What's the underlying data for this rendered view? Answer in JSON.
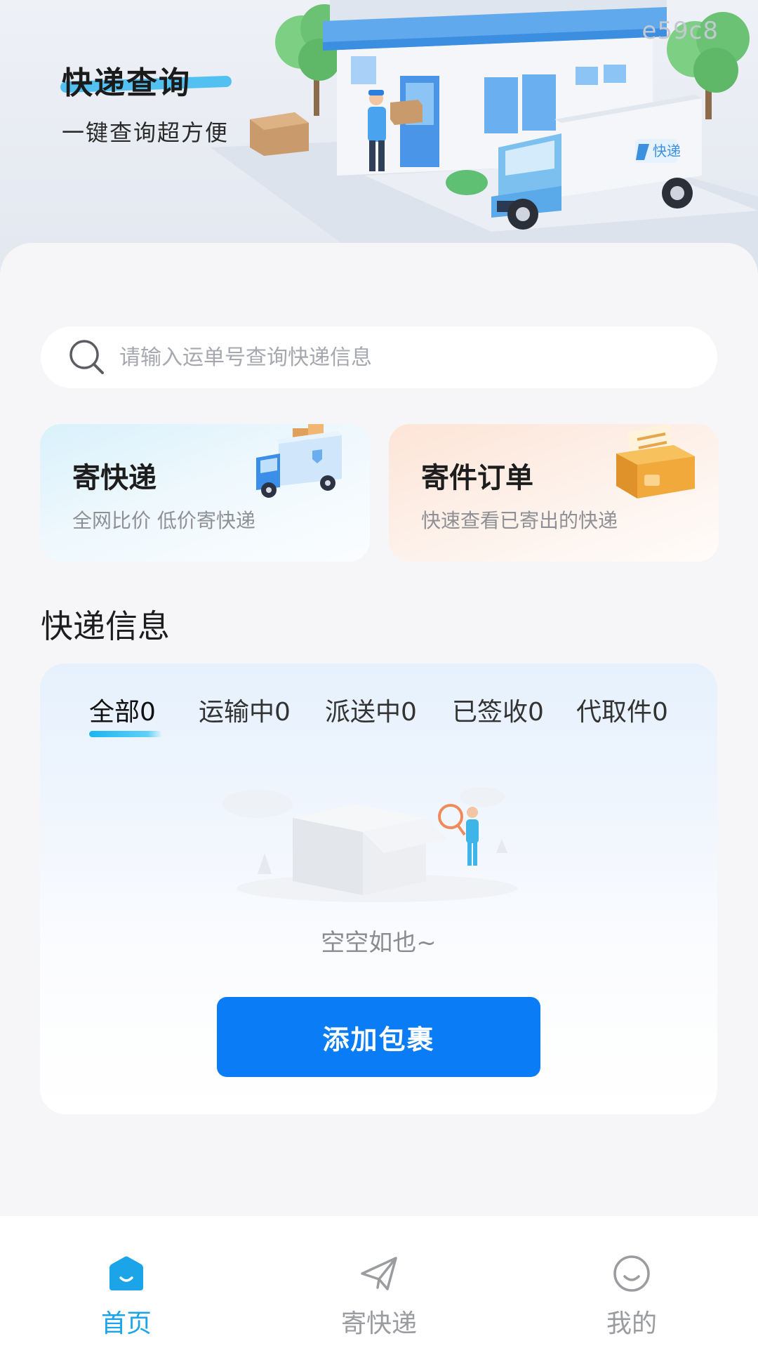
{
  "banner": {
    "title": "快递查询",
    "subtitle": "一键查询超方便",
    "code": "e59c8",
    "truck_label": "快递"
  },
  "search": {
    "placeholder": "请输入运单号查询快递信息",
    "value": ""
  },
  "cards": {
    "send": {
      "title": "寄快递",
      "subtitle": "全网比价 低价寄快递"
    },
    "orders": {
      "title": "寄件订单",
      "subtitle": "快速查看已寄出的快递"
    }
  },
  "section": {
    "title": "快递信息"
  },
  "tabs": [
    {
      "label": "全部0",
      "active": true
    },
    {
      "label": "运输中0",
      "active": false
    },
    {
      "label": "派送中0",
      "active": false
    },
    {
      "label": "已签收0",
      "active": false
    },
    {
      "label": "代取件0",
      "active": false
    }
  ],
  "empty_state": {
    "text": "空空如也~"
  },
  "actions": {
    "add_package": "添加包裹"
  },
  "bottom_nav": [
    {
      "label": "首页",
      "icon": "home-icon",
      "active": true
    },
    {
      "label": "寄快递",
      "icon": "paper-plane-icon",
      "active": false
    },
    {
      "label": "我的",
      "icon": "smiley-icon",
      "active": false
    }
  ],
  "colors": {
    "primary": "#0a7cf6",
    "accent": "#1ba5e8",
    "inactive": "#9a9ca0"
  }
}
